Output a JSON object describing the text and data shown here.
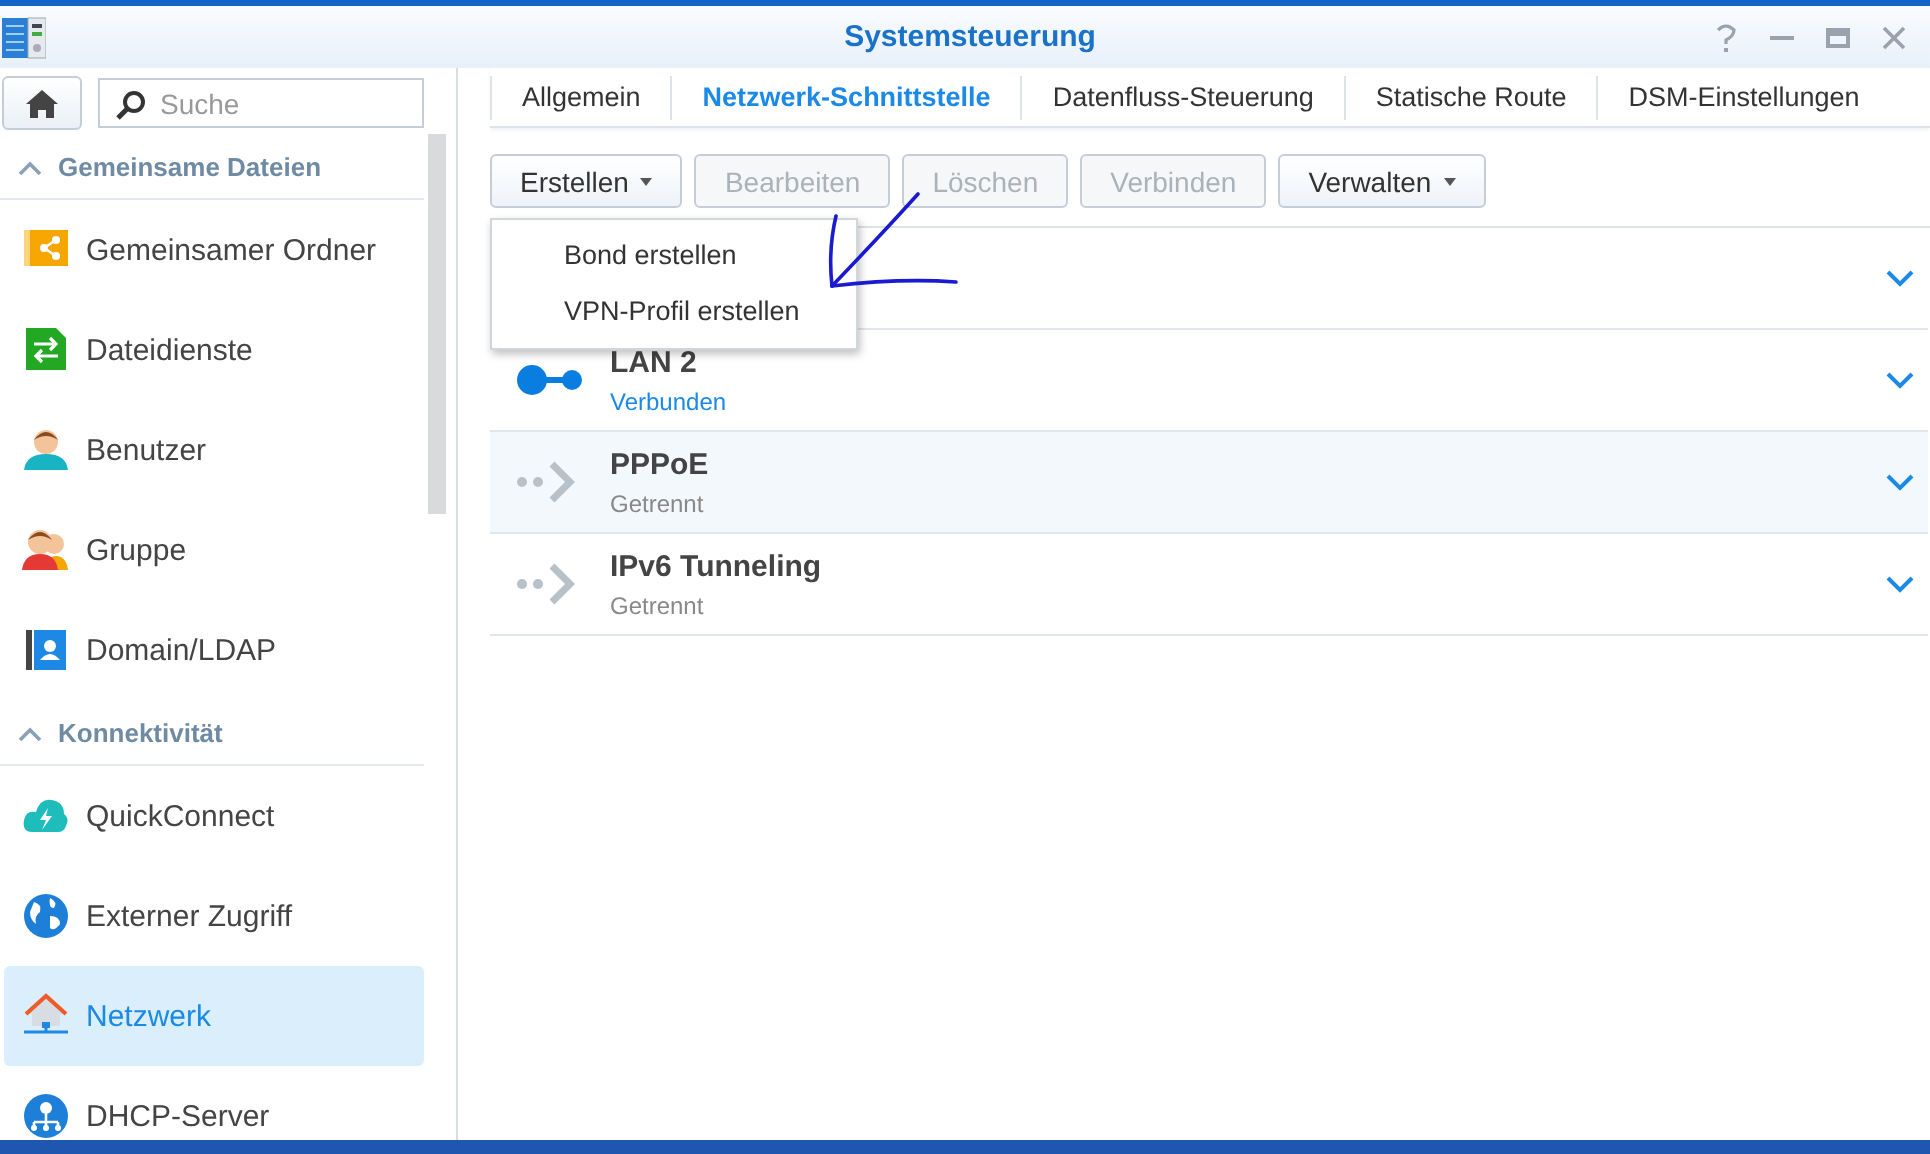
{
  "window": {
    "title": "Systemsteuerung"
  },
  "sidebar": {
    "search": {
      "placeholder": "Suche"
    },
    "sections": [
      {
        "title": "Gemeinsame Dateien",
        "expanded": true,
        "items": [
          {
            "label": "Gemeinsamer Ordner",
            "selected": false
          },
          {
            "label": "Dateidienste",
            "selected": false
          },
          {
            "label": "Benutzer",
            "selected": false
          },
          {
            "label": "Gruppe",
            "selected": false
          },
          {
            "label": "Domain/LDAP",
            "selected": false
          }
        ]
      },
      {
        "title": "Konnektivität",
        "expanded": true,
        "items": [
          {
            "label": "QuickConnect",
            "selected": false
          },
          {
            "label": "Externer Zugriff",
            "selected": false
          },
          {
            "label": "Netzwerk",
            "selected": true
          },
          {
            "label": "DHCP-Server",
            "selected": false
          }
        ]
      }
    ]
  },
  "tabs": [
    {
      "label": "Allgemein",
      "selected": false
    },
    {
      "label": "Netzwerk-Schnittstelle",
      "selected": true
    },
    {
      "label": "Datenfluss-Steuerung",
      "selected": false
    },
    {
      "label": "Statische Route",
      "selected": false
    },
    {
      "label": "DSM-Einstellungen",
      "selected": false
    }
  ],
  "toolbar": [
    {
      "label": "Erstellen",
      "dropdown": true,
      "disabled": false
    },
    {
      "label": "Bearbeiten",
      "dropdown": false,
      "disabled": true
    },
    {
      "label": "Löschen",
      "dropdown": false,
      "disabled": true
    },
    {
      "label": "Verbinden",
      "dropdown": false,
      "disabled": true
    },
    {
      "label": "Verwalten",
      "dropdown": true,
      "disabled": false
    }
  ],
  "menu": {
    "items": [
      "Bond erstellen",
      "VPN-Profil erstellen"
    ]
  },
  "interfaces": [
    {
      "kind": "covered",
      "selected": false
    },
    {
      "kind": "lan",
      "name": "LAN 2",
      "status": "Verbunden",
      "connected": true,
      "selected": false
    },
    {
      "kind": "tunnel",
      "name": "PPPoE",
      "status": "Getrennt",
      "connected": false,
      "selected": true
    },
    {
      "kind": "tunnel",
      "name": "IPv6 Tunneling",
      "status": "Getrennt",
      "connected": false,
      "selected": false
    }
  ]
}
